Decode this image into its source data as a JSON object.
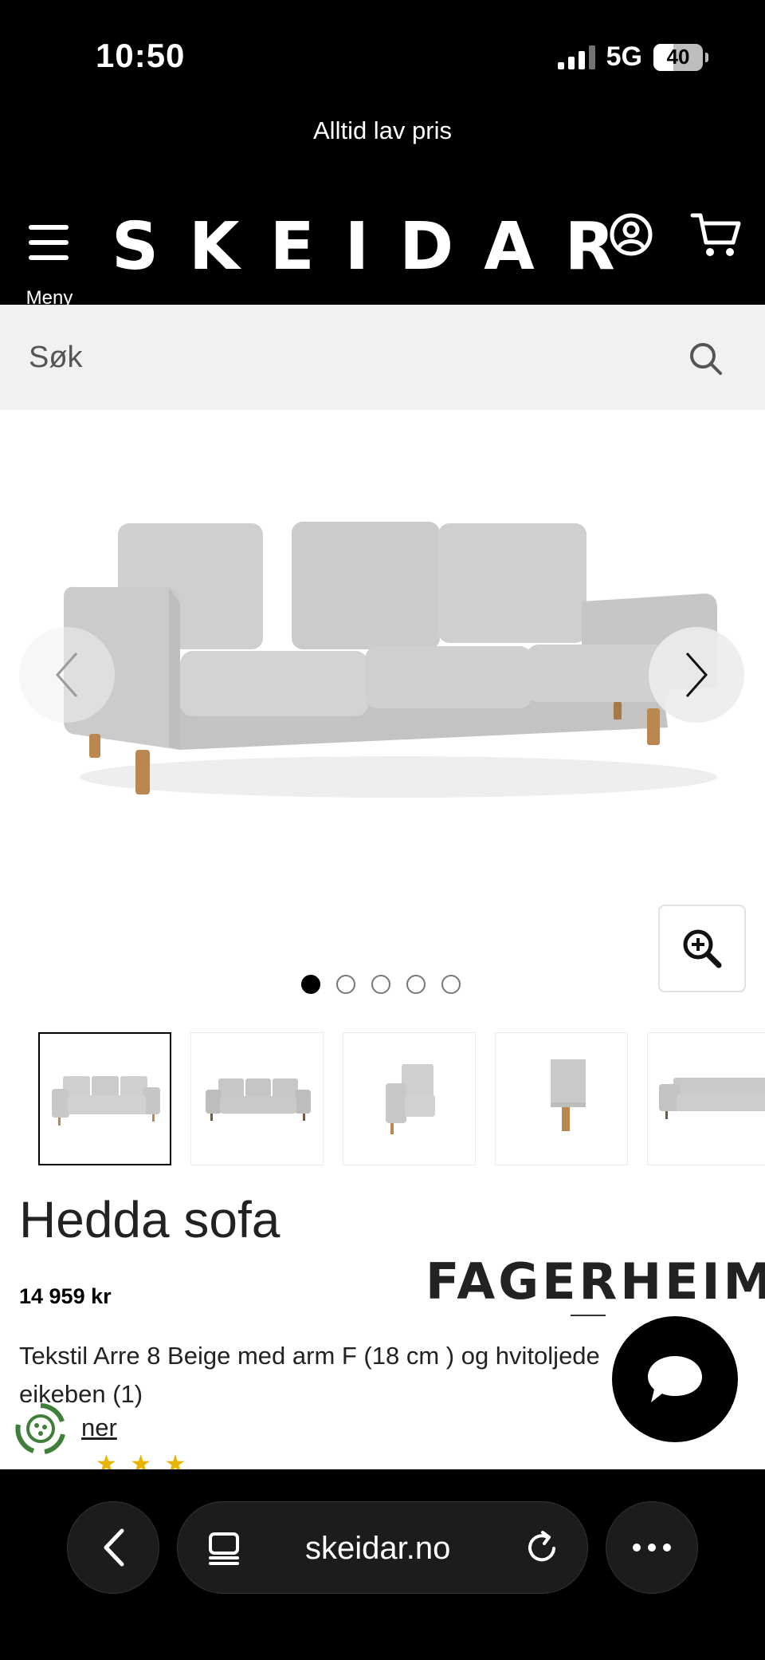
{
  "status_bar": {
    "time": "10:50",
    "network": "5G",
    "battery": "40",
    "battery_level": 0.4
  },
  "promo": {
    "text": "Alltid lav pris"
  },
  "header": {
    "menu_label": "Meny",
    "logo": "SKEIDAR",
    "account_icon": "user-circle-icon",
    "cart_icon": "shopping-cart-icon"
  },
  "search": {
    "placeholder": "Søk",
    "icon": "search-icon"
  },
  "gallery": {
    "image_count": 5,
    "active_index": 0,
    "prev_icon": "chevron-left-icon",
    "next_icon": "chevron-right-icon",
    "zoom_icon": "zoom-in-icon"
  },
  "product": {
    "title": "Hedda sofa",
    "price": "14 959 kr",
    "brand": "FAGERHEIM",
    "description": "Tekstil Arre 8 Beige med arm F (18 cm ) og hvitoljede eikeben (1)",
    "more_link": "ner"
  },
  "chat": {
    "icon": "chat-bubble-icon"
  },
  "browser": {
    "url": "skeidar.no",
    "back_icon": "chevron-left-icon",
    "tabs_icon": "tabs-icon",
    "reload_icon": "reload-icon",
    "more_icon": "ellipsis-icon"
  },
  "colors": {
    "header_bg": "#000000",
    "search_bg": "#f1f1f1",
    "sofa_fabric": "#c9c9c7",
    "leg_wood": "#b9874f"
  }
}
